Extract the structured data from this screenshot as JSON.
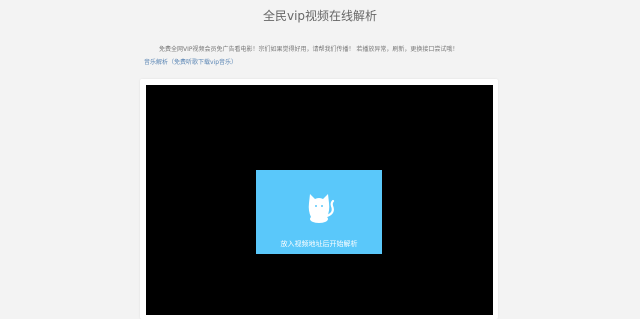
{
  "header": {
    "title": "全民vip视频在线解析"
  },
  "content": {
    "notice": "免费全网VIP视频会员免广告看电影！宗们如果觉得好用，请帮我们传播！ 若播放异常，刷新，更换接口尝试哦！",
    "music_link": "音乐解析（免费听歌下载vip音乐）"
  },
  "player": {
    "hint": "放入视频地址后开始解析",
    "icon": "cat-icon",
    "colors": {
      "screen": "#000000",
      "card": "#5ac8fa"
    }
  }
}
